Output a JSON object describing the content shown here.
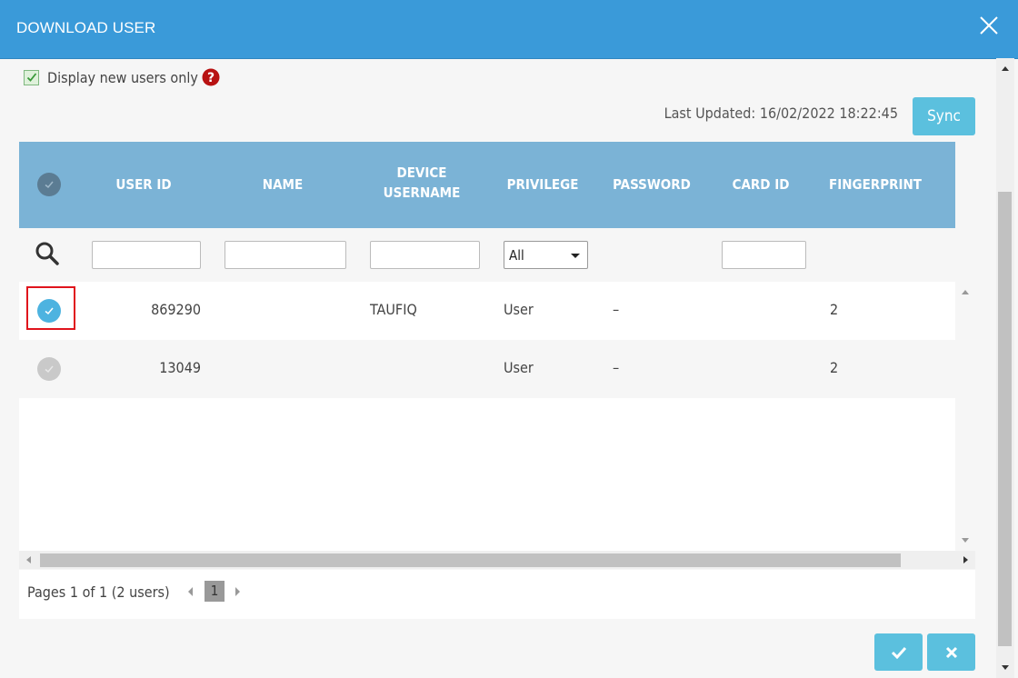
{
  "dialog": {
    "title": "DOWNLOAD USER"
  },
  "options": {
    "display_new_users_only": "Display new users only",
    "checked": true
  },
  "sync": {
    "last_updated": "Last Updated: 16/02/2022 18:22:45",
    "button": "Sync"
  },
  "table": {
    "headers": {
      "user_id": "USER ID",
      "name": "NAME",
      "device_username_1": "DEVICE",
      "device_username_2": "USERNAME",
      "privilege": "PRIVILEGE",
      "password": "PASSWORD",
      "card_id": "CARD ID",
      "fingerprint": "FINGERPRINT"
    },
    "filters": {
      "privilege_selected": "All"
    },
    "rows": [
      {
        "selected": true,
        "user_id": "869290",
        "name": "",
        "device_username": "TAUFIQ",
        "privilege": "User",
        "password": "–",
        "card_id": "",
        "fingerprint": "2"
      },
      {
        "selected": false,
        "user_id": "13049",
        "name": "",
        "device_username": "",
        "privilege": "User",
        "password": "–",
        "card_id": "",
        "fingerprint": "2"
      }
    ]
  },
  "pager": {
    "info": "Pages 1 of 1 (2 users)",
    "current_page": "1"
  },
  "colors": {
    "header_bar": "#3a9ad9",
    "table_header": "#7bb3d6",
    "accent_button": "#5bc0de",
    "highlight": "#e0141c"
  },
  "icons": [
    "close-icon",
    "check-icon",
    "help-icon",
    "search-icon",
    "caret-down-icon",
    "times-icon"
  ]
}
